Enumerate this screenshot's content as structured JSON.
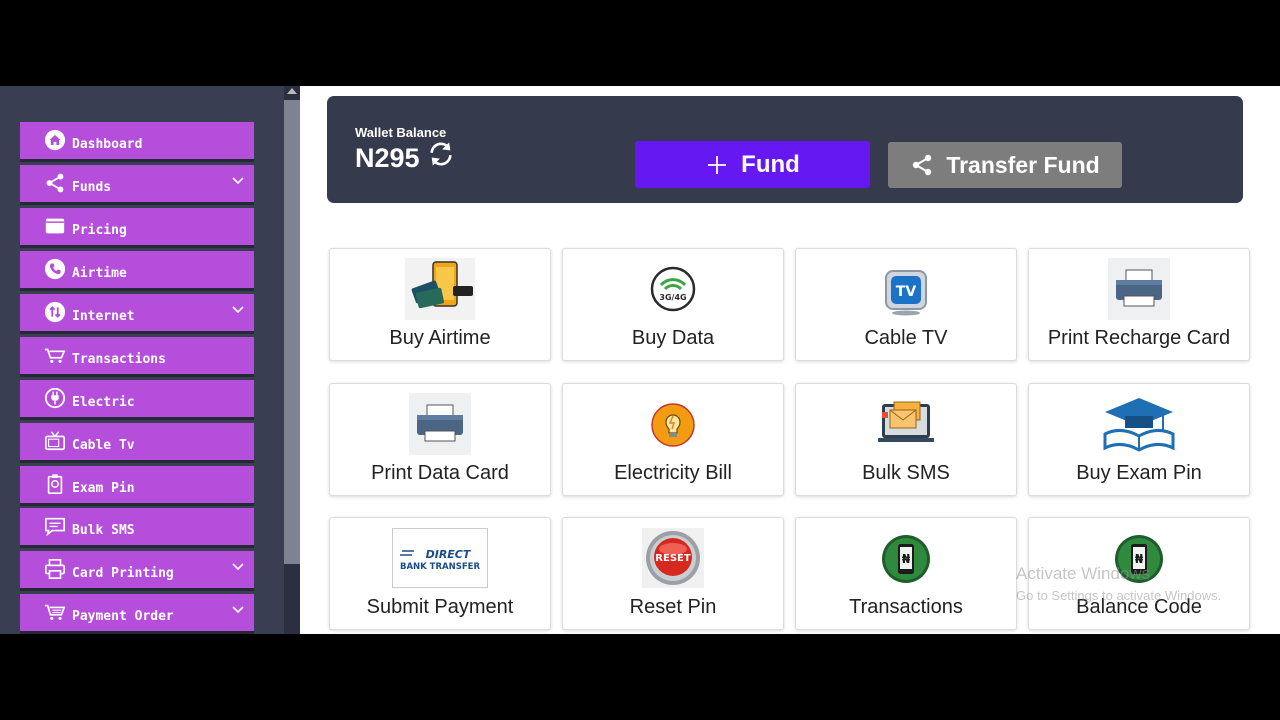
{
  "sidebar": {
    "items": [
      {
        "label": "Dashboard",
        "icon": "home-icon",
        "dropdown": false
      },
      {
        "label": "Funds",
        "icon": "share-icon",
        "dropdown": true
      },
      {
        "label": "Pricing",
        "icon": "wallet-icon",
        "dropdown": false
      },
      {
        "label": "Airtime",
        "icon": "phone-icon",
        "dropdown": false
      },
      {
        "label": "Internet",
        "icon": "data-transfer-icon",
        "dropdown": true
      },
      {
        "label": "Transactions",
        "icon": "cart-icon",
        "dropdown": false
      },
      {
        "label": "Electric",
        "icon": "plug-icon",
        "dropdown": false
      },
      {
        "label": "Cable Tv",
        "icon": "tv-icon",
        "dropdown": false
      },
      {
        "label": "Exam Pin",
        "icon": "certificate-icon",
        "dropdown": false
      },
      {
        "label": "Bulk SMS",
        "icon": "sms-icon",
        "dropdown": false
      },
      {
        "label": "Card Printing",
        "icon": "printer-icon",
        "dropdown": true
      },
      {
        "label": "Payment Order",
        "icon": "cart-icon",
        "dropdown": true
      }
    ]
  },
  "wallet": {
    "label": "Wallet Balance",
    "amount": "N295",
    "fund_label": "Fund",
    "transfer_label": "Transfer Fund"
  },
  "services": [
    {
      "label": "Buy Airtime",
      "icon": "airtime-phone-icon"
    },
    {
      "label": "Buy Data",
      "icon": "wifi-3g4g-icon"
    },
    {
      "label": "Cable TV",
      "icon": "tv-badge-icon"
    },
    {
      "label": "Print Recharge Card",
      "icon": "printer-icon"
    },
    {
      "label": "Print Data Card",
      "icon": "printer-icon"
    },
    {
      "label": "Electricity Bill",
      "icon": "lightbulb-icon"
    },
    {
      "label": "Bulk SMS",
      "icon": "envelopes-icon"
    },
    {
      "label": "Buy Exam Pin",
      "icon": "graduation-cap-icon"
    },
    {
      "label": "Submit Payment",
      "icon": "direct-bank-transfer-icon",
      "logo_text_1": "DIRECT",
      "logo_text_2": "BANK TRANSFER"
    },
    {
      "label": "Reset Pin",
      "icon": "reset-button-icon",
      "logo_text": "RESET"
    },
    {
      "label": "Transactions",
      "icon": "naira-phone-icon"
    },
    {
      "label": "Balance Code",
      "icon": "naira-phone-icon"
    }
  ],
  "watermark": {
    "line1": "Activate Windows",
    "line2": "Go to Settings to activate Windows."
  },
  "colors": {
    "sidebar_bg": "#393e52",
    "nav_item_bg": "#b54fdb",
    "wallet_bg": "#363a4d",
    "fund_button": "#6618f3",
    "transfer_button": "#7d7d7d"
  }
}
